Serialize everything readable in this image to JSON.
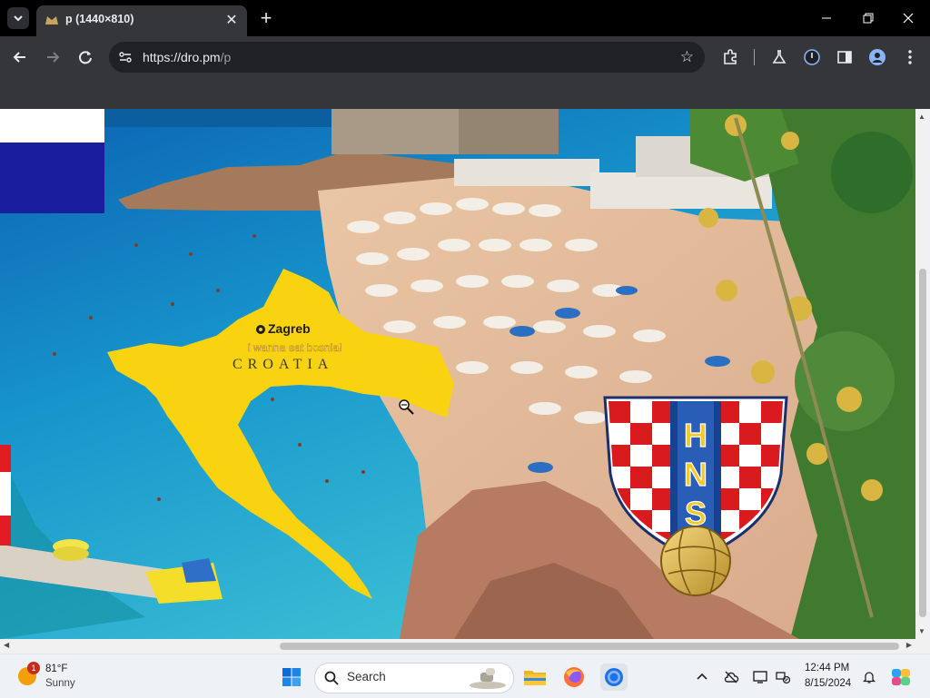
{
  "browser": {
    "tab_title": "p (1440×810)",
    "url_host": "https://dro.pm",
    "url_path": "/p"
  },
  "page": {
    "map_city": "Zagreb",
    "map_caption": "i wanna eat bosnia!",
    "map_country": "CROATIA",
    "crest_letters": [
      "H",
      "N",
      "S"
    ]
  },
  "taskbar": {
    "weather_temp": "81°F",
    "weather_desc": "Sunny",
    "weather_badge": "1",
    "search_placeholder": "Search",
    "time": "12:44 PM",
    "date": "8/15/2024"
  },
  "icons": {
    "tab_search": "chevron-down-icon",
    "back": "arrow-left-icon",
    "forward": "arrow-right-icon",
    "reload": "reload-icon",
    "bookmark": "star-icon",
    "extensions": "puzzle-icon",
    "labs": "flask-icon",
    "profile": "person-icon",
    "menu": "kebab-menu-icon"
  },
  "colors": {
    "map_yellow": "#f9d210",
    "sea": "#18a0c8",
    "crest_red": "#d91a1f",
    "crest_blue": "#17428f"
  }
}
